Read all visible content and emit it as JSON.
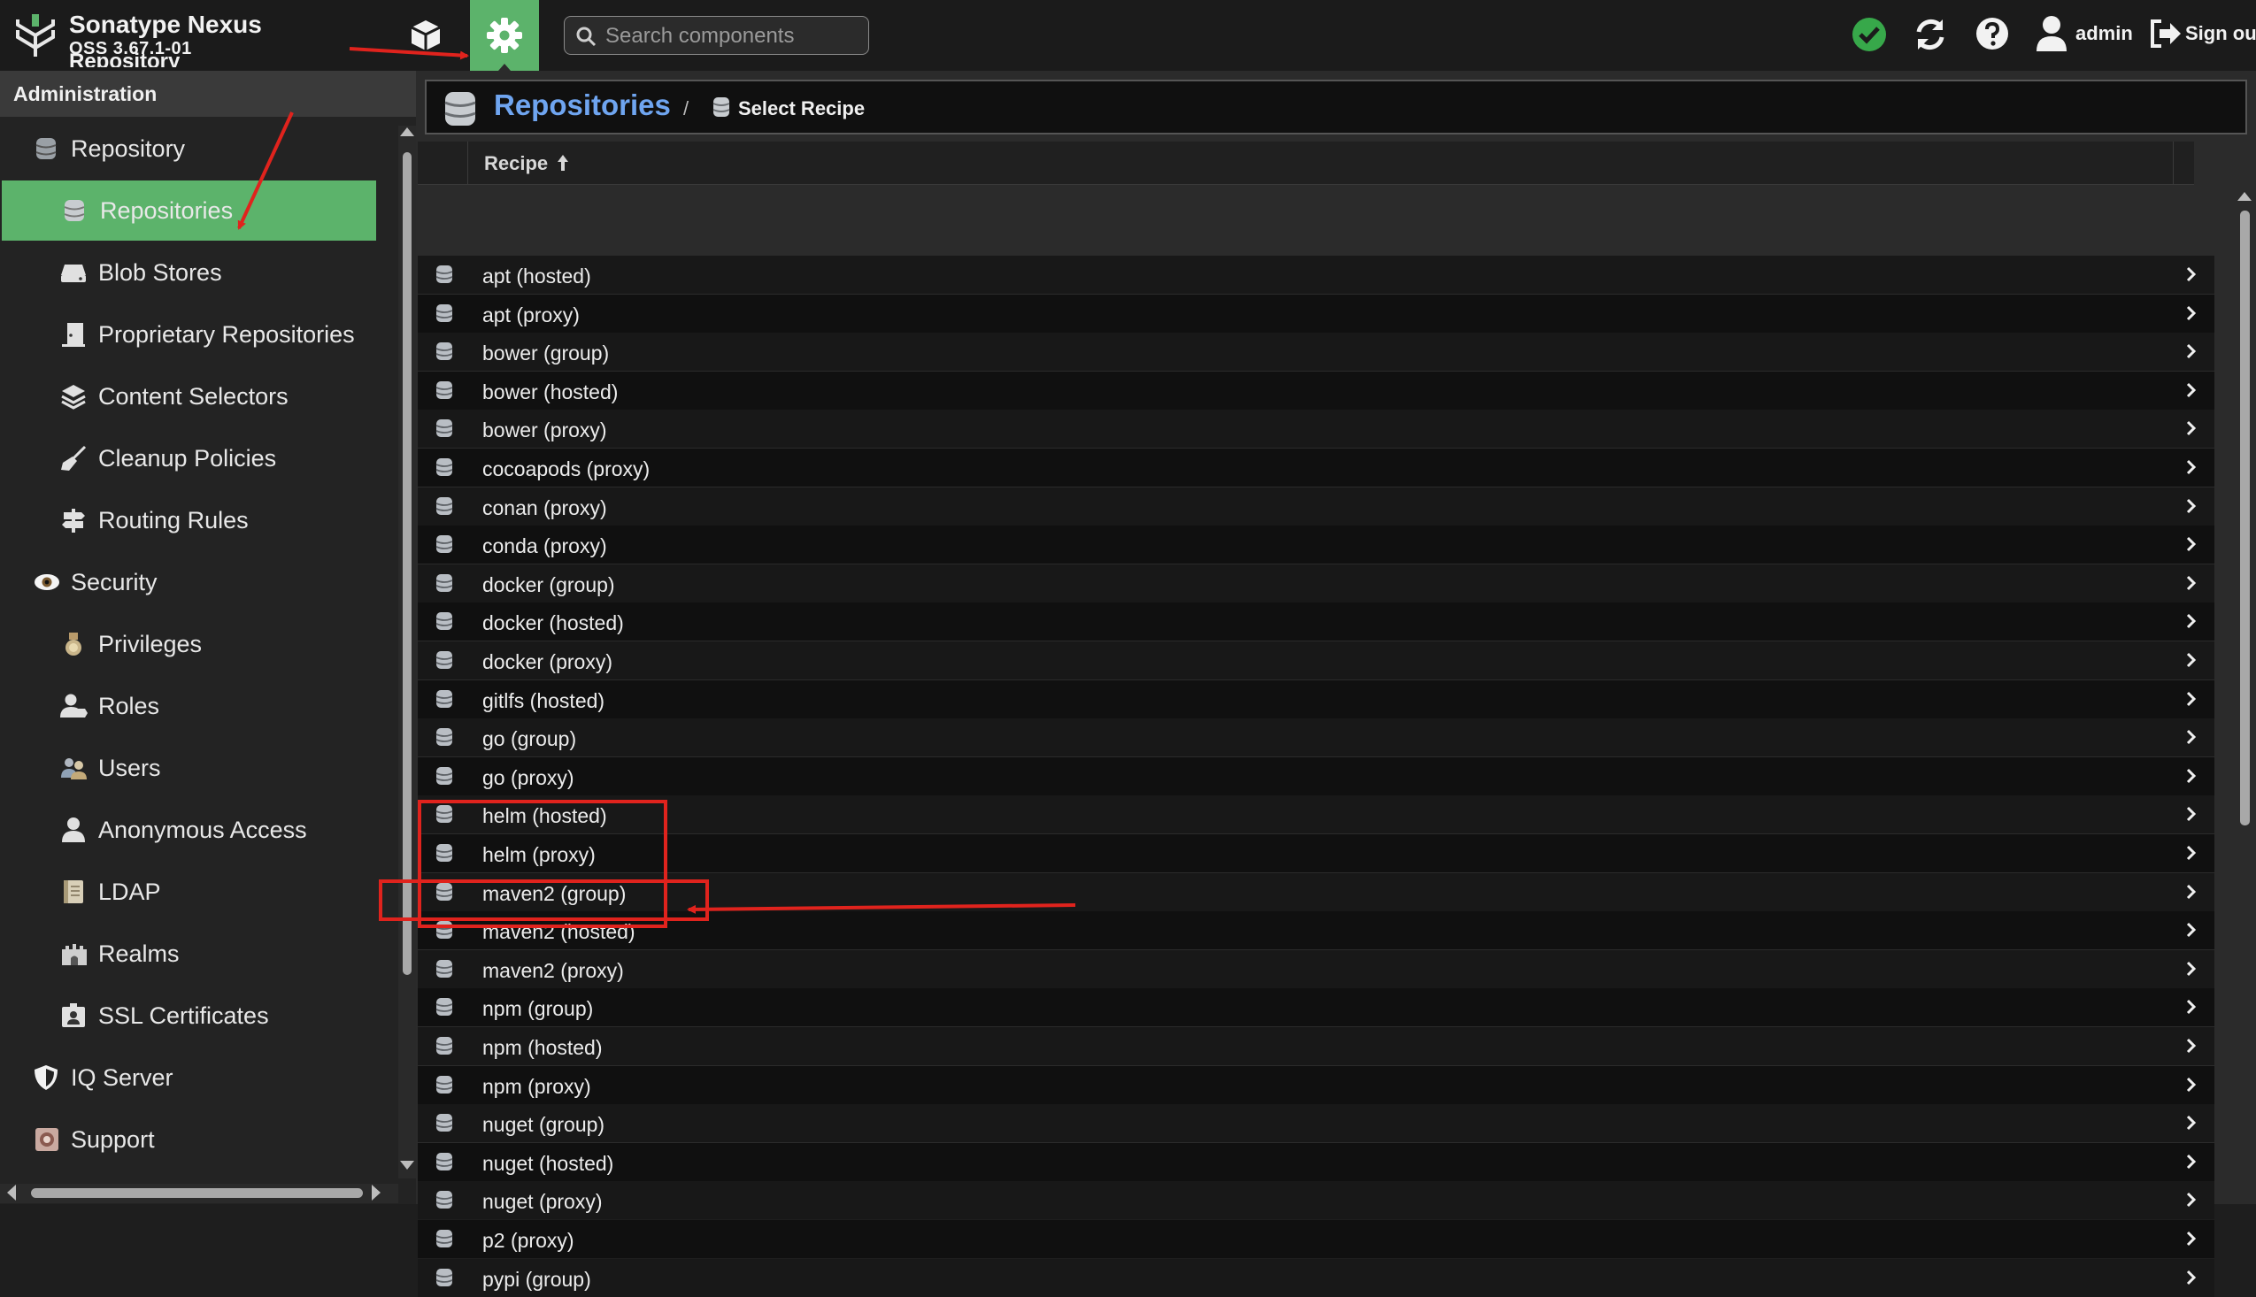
{
  "header": {
    "brand_title": "Sonatype Nexus",
    "brand_version": "OSS 3.67.1-01",
    "brand_subtitle": "Repository",
    "search_placeholder": "Search components",
    "user_name": "admin",
    "sign_out_label": "Sign ou",
    "accent_color": "#5cb36b"
  },
  "sidebar": {
    "header": "Administration",
    "items": [
      {
        "label": "Repository",
        "icon": "database-icon",
        "level": 0
      },
      {
        "label": "Repositories",
        "icon": "database-icon",
        "level": 1,
        "active": true
      },
      {
        "label": "Blob Stores",
        "icon": "drive-icon",
        "level": 1
      },
      {
        "label": "Proprietary Repositories",
        "icon": "door-icon",
        "level": 1
      },
      {
        "label": "Content Selectors",
        "icon": "layers-icon",
        "level": 1
      },
      {
        "label": "Cleanup Policies",
        "icon": "broom-icon",
        "level": 1
      },
      {
        "label": "Routing Rules",
        "icon": "signpost-icon",
        "level": 1
      },
      {
        "label": "Security",
        "icon": "eye-icon",
        "level": 0
      },
      {
        "label": "Privileges",
        "icon": "medal-icon",
        "level": 1
      },
      {
        "label": "Roles",
        "icon": "user-tag-icon",
        "level": 1
      },
      {
        "label": "Users",
        "icon": "users-icon",
        "level": 1
      },
      {
        "label": "Anonymous Access",
        "icon": "user-icon",
        "level": 1
      },
      {
        "label": "LDAP",
        "icon": "book-icon",
        "level": 1
      },
      {
        "label": "Realms",
        "icon": "castle-icon",
        "level": 1
      },
      {
        "label": "SSL Certificates",
        "icon": "id-card-icon",
        "level": 1
      },
      {
        "label": "IQ Server",
        "icon": "shield-icon",
        "level": 0
      },
      {
        "label": "Support",
        "icon": "support-icon",
        "level": 0
      }
    ]
  },
  "breadcrumb": {
    "title": "Repositories",
    "separator": "/",
    "current": "Select Recipe"
  },
  "grid": {
    "column_header": "Recipe",
    "sort_direction": "ascending",
    "rows": [
      "apt (hosted)",
      "apt (proxy)",
      "bower (group)",
      "bower (hosted)",
      "bower (proxy)",
      "cocoapods (proxy)",
      "conan (proxy)",
      "conda (proxy)",
      "docker (group)",
      "docker (hosted)",
      "docker (proxy)",
      "gitlfs (hosted)",
      "go (group)",
      "go (proxy)",
      "helm (hosted)",
      "helm (proxy)",
      "maven2 (group)",
      "maven2 (hosted)",
      "maven2 (proxy)",
      "npm (group)",
      "npm (hosted)",
      "npm (proxy)",
      "nuget (group)",
      "nuget (hosted)",
      "nuget (proxy)",
      "p2 (proxy)",
      "pypi (group)"
    ]
  },
  "annotations": {
    "color": "#e0231d"
  }
}
